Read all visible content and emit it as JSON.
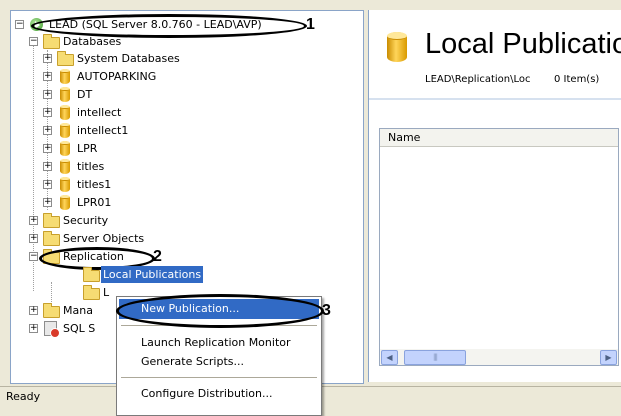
{
  "tree": {
    "root_label": "LEAD (SQL Server 8.0.760 - LEAD\\AVP)",
    "databases_label": "Databases",
    "database_items": [
      "System Databases",
      "AUTOPARKING",
      "DT",
      "intellect",
      "intellect1",
      "LPR",
      "titles",
      "titles1",
      "LPR01"
    ],
    "security_label": "Security",
    "server_objects_label": "Server Objects",
    "replication_label": "Replication",
    "local_publications_label": "Local Publications",
    "local_subscriptions_label": "L",
    "management_label": "Mana",
    "sql_agent_label": "SQL S"
  },
  "panel": {
    "title": "Local Publicatio",
    "path": "LEAD\\Replication\\Loc",
    "count": "0 Item(s)",
    "column_name": "Name"
  },
  "context_menu": {
    "items": [
      "New Publication...",
      "Launch Replication Monitor",
      "Generate Scripts...",
      "Configure Distribution..."
    ]
  },
  "annotations": [
    "1",
    "2",
    "3"
  ],
  "status": {
    "text": "Ready"
  },
  "colors": {
    "selection": "#316ac5",
    "folder": "#f6dc73",
    "background": "#ece9d8"
  },
  "icons": [
    "server-icon",
    "folder-icon",
    "database-icon",
    "sql-agent-icon"
  ]
}
